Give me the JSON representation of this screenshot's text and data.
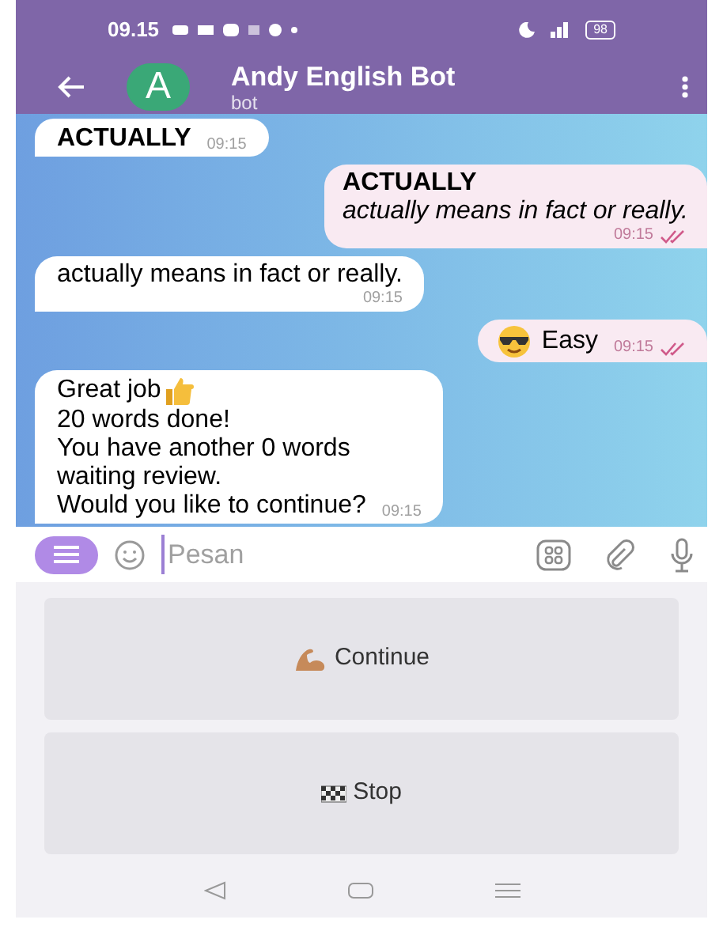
{
  "status_bar": {
    "time": "09.15",
    "battery": "98"
  },
  "header": {
    "title": "Andy English Bot",
    "subtitle": "bot",
    "avatar_letter": "A"
  },
  "messages": [
    {
      "kind": "incoming",
      "heading": "ACTUALLY",
      "time": "09:15"
    },
    {
      "kind": "outgoing",
      "heading": "ACTUALLY",
      "note": "actually means in fact or really.",
      "time": "09:15",
      "read": true
    },
    {
      "kind": "incoming",
      "lines": [
        "actually means in fact or really."
      ],
      "time": "09:15"
    },
    {
      "kind": "outgoing",
      "lines": [
        "Easy"
      ],
      "time": "09:15",
      "read": true
    },
    {
      "kind": "incoming",
      "lines": [
        "Great job",
        "20 words done!",
        "You have another 0 words",
        "waiting review.",
        "Would you like to continue?"
      ],
      "time": "09:15"
    }
  ],
  "composer": {
    "placeholder": "Pesan"
  },
  "keyboard": [
    {
      "label": "Continue"
    },
    {
      "label": "Stop"
    }
  ]
}
